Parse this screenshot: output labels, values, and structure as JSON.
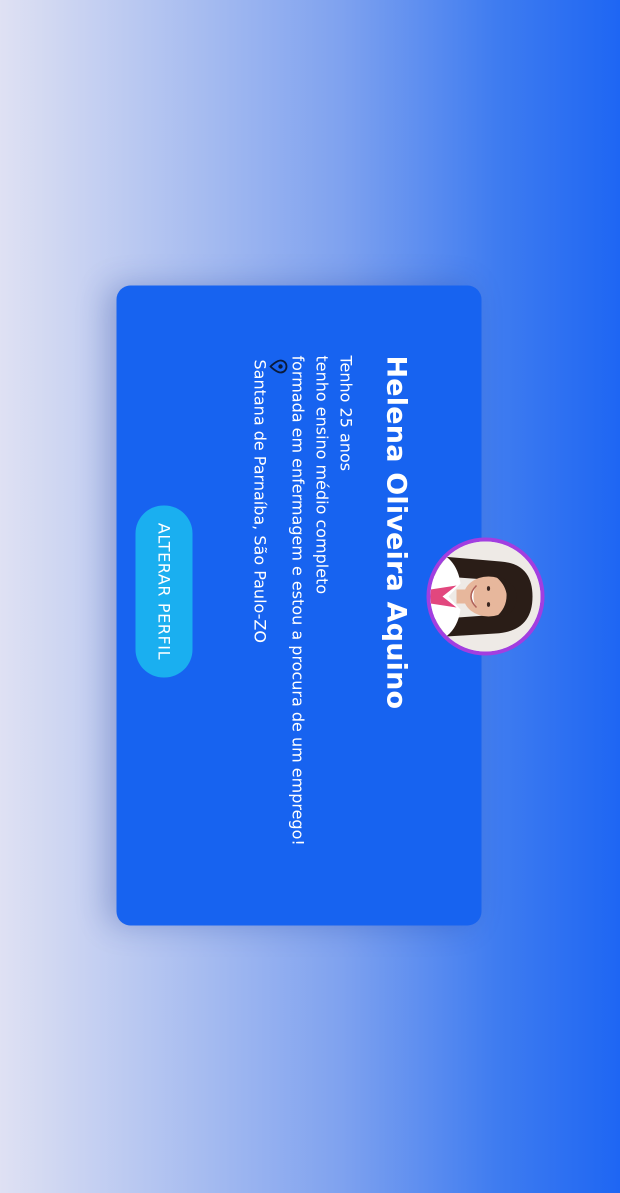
{
  "profile": {
    "name": "Helena Oliveira Aquino",
    "bio_lines": [
      "Tenho 25 anos",
      "tenho ensino médio completo",
      "formada em enfermagem e estou a procura de um emprego!"
    ],
    "location": "Santana de Parnaíba, São Paulo-ZO",
    "location_icon": "location-pin-icon",
    "button_label": "ALTERAR PERFIL"
  },
  "colors": {
    "card": "#1763f0",
    "button": "#1aaff0",
    "avatar_border": "#a23ee0",
    "text": "#ffffff"
  }
}
